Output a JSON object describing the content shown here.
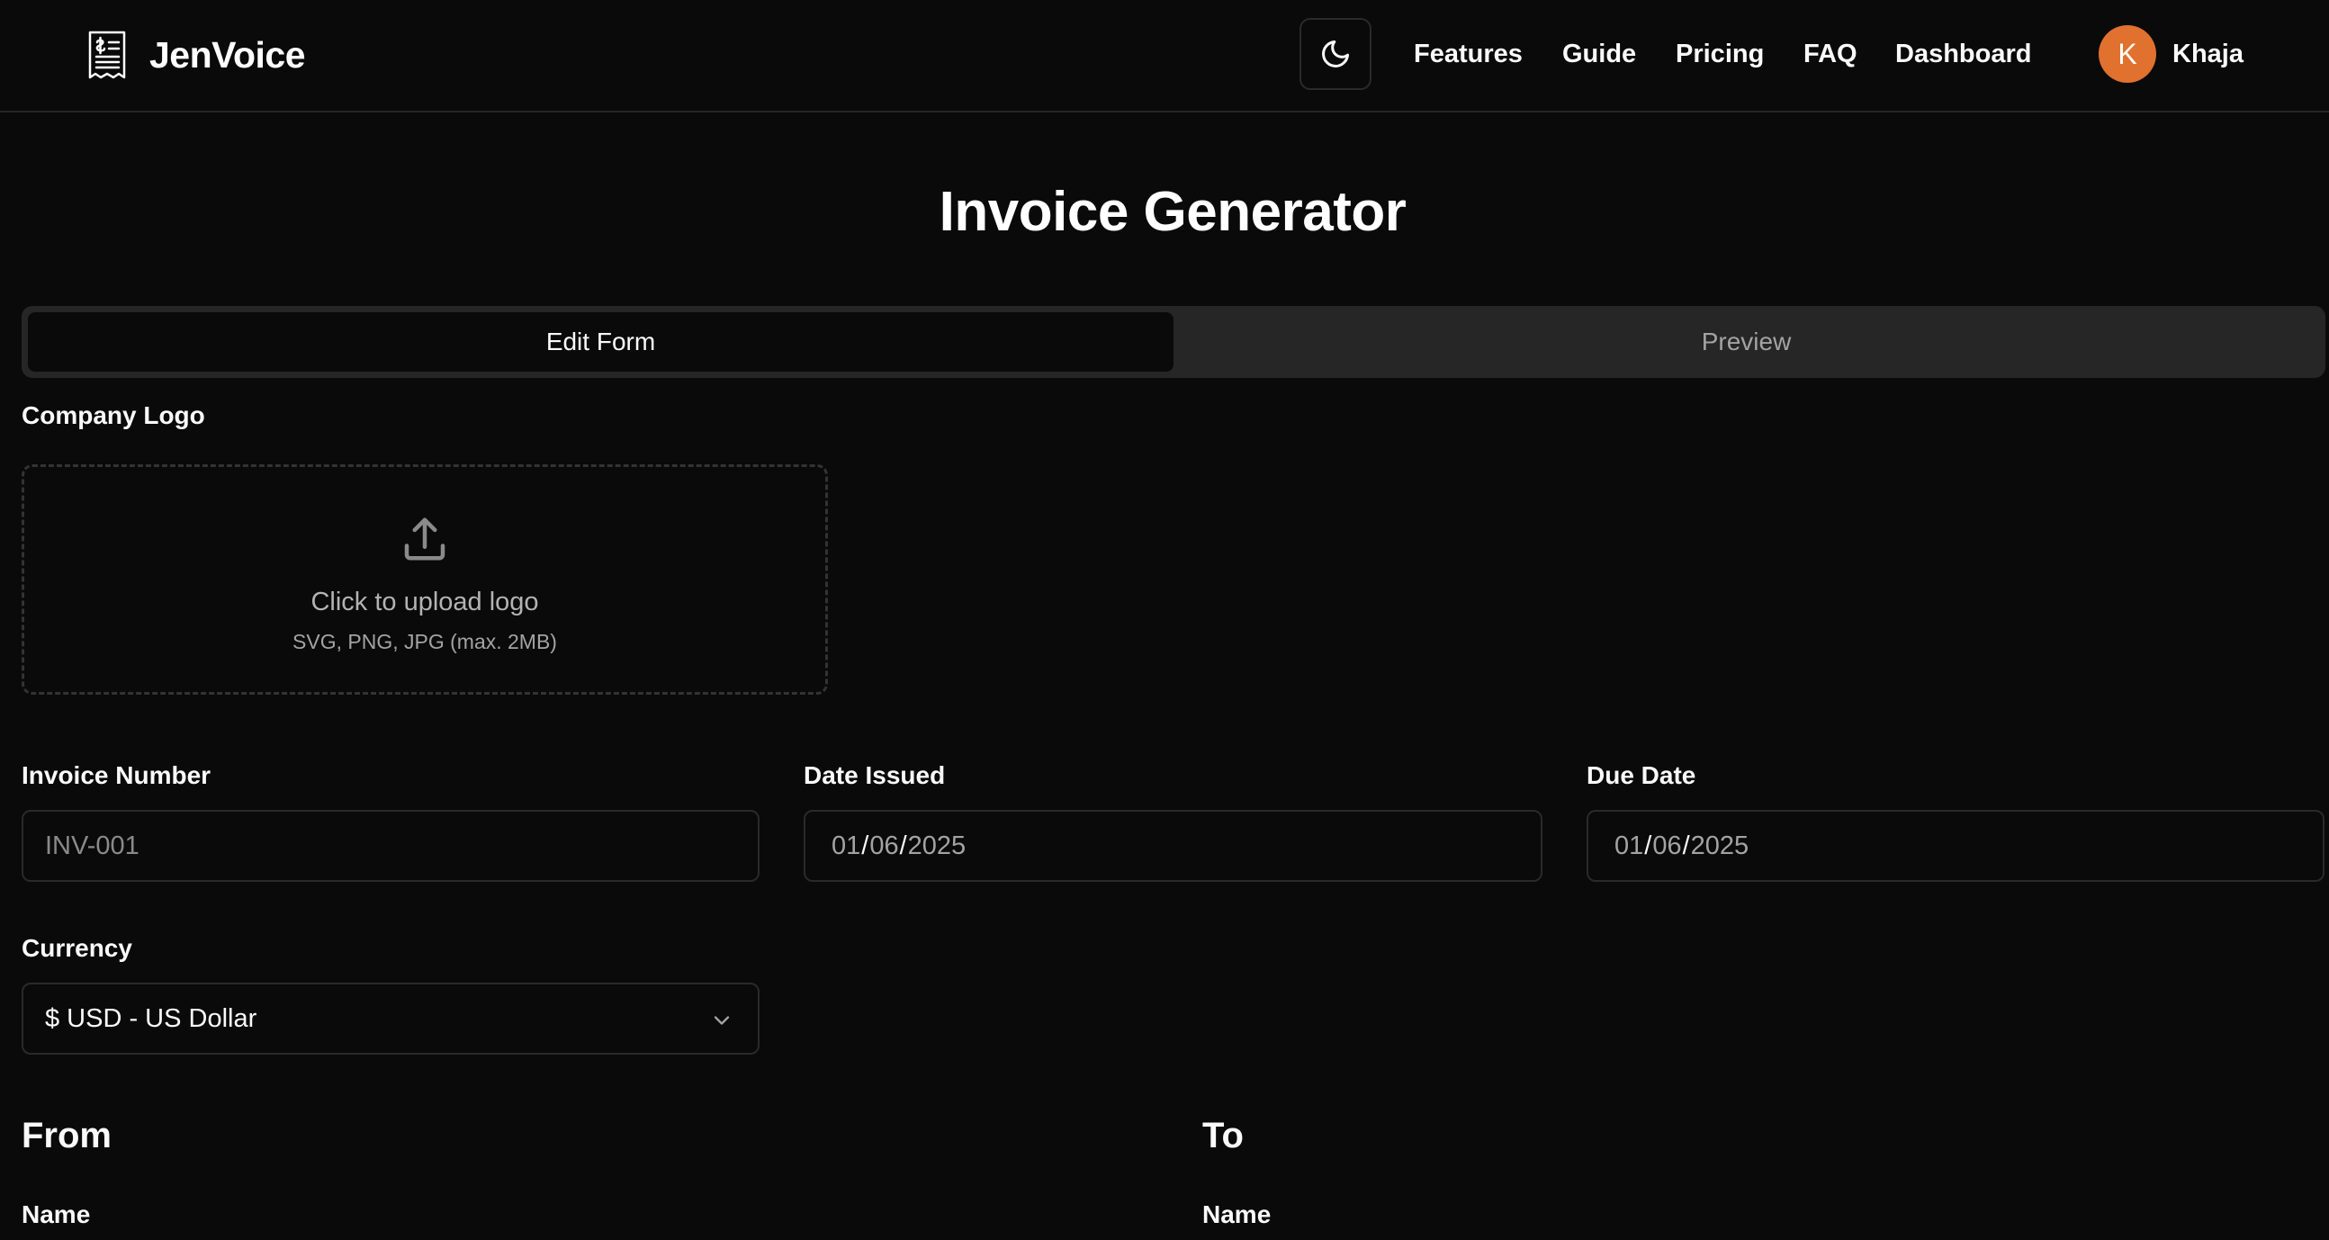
{
  "header": {
    "brand_name": "JenVoice",
    "nav": [
      "Features",
      "Guide",
      "Pricing",
      "FAQ",
      "Dashboard"
    ],
    "user": {
      "initial": "K",
      "name": "Khaja"
    }
  },
  "page": {
    "title": "Invoice Generator"
  },
  "tabs": {
    "edit": "Edit Form",
    "preview": "Preview"
  },
  "logo": {
    "label": "Company Logo",
    "upload_text": "Click to upload logo",
    "upload_hint": "SVG, PNG, JPG (max. 2MB)"
  },
  "invoice": {
    "number_label": "Invoice Number",
    "number_placeholder": "INV-001",
    "date_issued_label": "Date Issued",
    "date_issued": {
      "month": "01",
      "day": "06",
      "year": "2025"
    },
    "due_date_label": "Due Date",
    "due_date": {
      "month": "01",
      "day": "06",
      "year": "2025"
    }
  },
  "currency": {
    "label": "Currency",
    "value": "$ USD - US Dollar"
  },
  "from": {
    "title": "From",
    "name_label": "Name"
  },
  "to": {
    "title": "To",
    "name_label": "Name"
  },
  "colors": {
    "background": "#0a0a0a",
    "avatar": "#e0712e",
    "tab_bar": "#262626"
  }
}
